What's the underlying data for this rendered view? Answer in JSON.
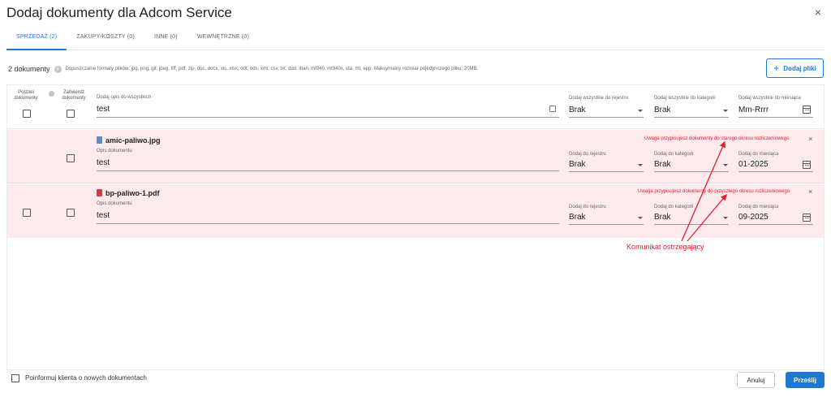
{
  "dialog": {
    "title": "Dodaj dokumenty dla Adcom Service",
    "close": "×"
  },
  "tabs": [
    {
      "label": "SPRZEDAŻ (2)",
      "active": true
    },
    {
      "label": "ZAKUPY/KOSZTY (0)",
      "active": false
    },
    {
      "label": "INNE (0)",
      "active": false
    },
    {
      "label": "WEWNĘTRZNE (0)",
      "active": false
    }
  ],
  "info": {
    "count": "2 dokumenty",
    "formats": "Dopuszczalne formaty plików: jpg, png, gif, jpeg, tiff, pdf, zip, doc, docx, xls, xlsx, odt, ods, xml, csv, txt, ddd, iban, mt940, mt940x, sta, mt, epp. Maksymalny rozmiar pojedynczego pliku: 20MB."
  },
  "add_files": {
    "label": "Dodaj pliki",
    "icon": "plus-icon"
  },
  "header": {
    "split_label": "Podziel dokumenty",
    "approve_label": "Zatwierdź dokumenty",
    "desc_label": "Dodaj opis do wszystkich",
    "desc_value": "test",
    "register_label": "Dodaj wszystkie do rejestru",
    "register_value": "Brak",
    "category_label": "Dodaj wszystkie do kategorii",
    "category_value": "Brak",
    "month_label": "Dodaj wszystkie do miesiąca",
    "month_value": "Mm-Rrrr"
  },
  "documents": [
    {
      "file_name": "amic-paliwo.jpg",
      "file_type": "jpg",
      "desc_label": "Opis dokumentu",
      "desc_value": "test",
      "register_label": "Dodaj do rejestru",
      "register_value": "Brak",
      "category_label": "Dodaj do kategorii",
      "category_value": "Brak",
      "month_label": "Dodaj do miesiąca",
      "month_value": "01-2025",
      "warning": "Uwaga przypisujesz dokumenty do starego okresu rozliczeniowego"
    },
    {
      "file_name": "bp-paliwo-1.pdf",
      "file_type": "pdf",
      "desc_label": "Opis dokumentu",
      "desc_value": "test",
      "register_label": "Dodaj do rejestru",
      "register_value": "Brak",
      "category_label": "Dodaj do kategorii",
      "category_value": "Brak",
      "month_label": "Dodaj do miesiąca",
      "month_value": "09-2025",
      "warning": "Uwaga przypisujesz dokumenty do przyszłego okresu rozliczeniowego"
    }
  ],
  "annotation": {
    "text": "Komunikat ostrzegający",
    "color": "#e2202e"
  },
  "footer": {
    "notify_label": "Poinformuj klienta o nowych dokumentach",
    "cancel_label": "Anuluj",
    "send_label": "Prześlij"
  },
  "colors": {
    "accent": "#1e78d2",
    "warning_bg": "#fdeaed",
    "warning_text": "#e2202e"
  }
}
